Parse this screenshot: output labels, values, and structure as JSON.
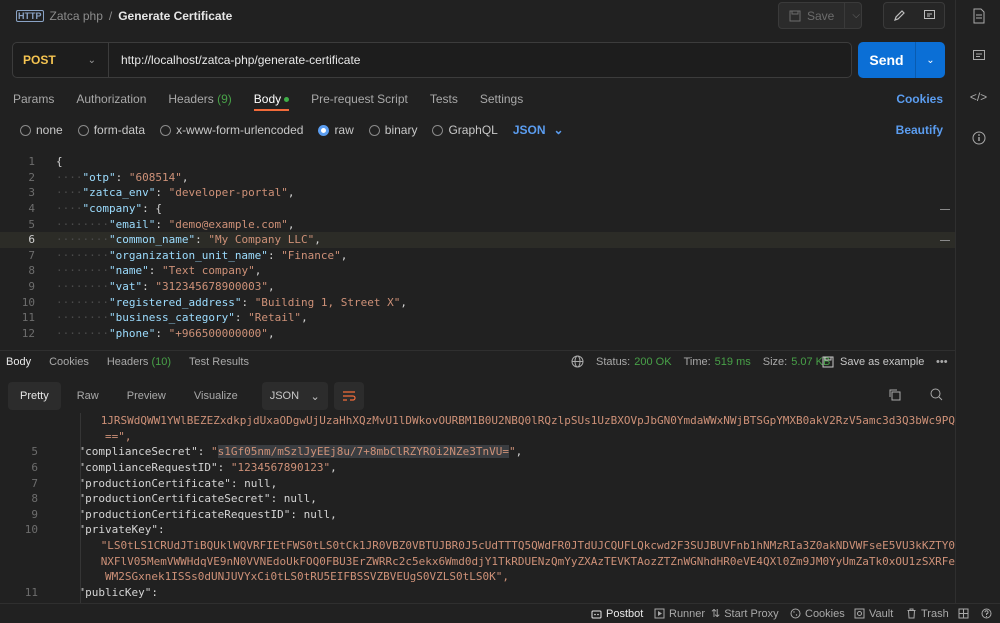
{
  "breadcrumb": {
    "collection": "Zatca php",
    "separator": "/",
    "request": "Generate Certificate",
    "icon": "http-icon"
  },
  "toolbar": {
    "save_label": "Save"
  },
  "request": {
    "method": "POST",
    "url": "http://localhost/zatca-php/generate-certificate",
    "send_label": "Send"
  },
  "req_tabs": [
    {
      "label": "Params"
    },
    {
      "label": "Authorization"
    },
    {
      "label": "Headers",
      "count": "(9)"
    },
    {
      "label": "Body",
      "active": true
    },
    {
      "label": "Pre-request Script"
    },
    {
      "label": "Tests"
    },
    {
      "label": "Settings"
    }
  ],
  "cookies_label": "Cookies",
  "body_types": [
    "none",
    "form-data",
    "x-www-form-urlencoded",
    "raw",
    "binary",
    "GraphQL"
  ],
  "body_selected": "raw",
  "body_format": "JSON",
  "beautify_label": "Beautify",
  "editor_lines": [
    {
      "n": "1",
      "parts": [
        [
          "p",
          "{"
        ]
      ]
    },
    {
      "n": "2",
      "parts": [
        [
          "ws",
          "····"
        ],
        [
          "k",
          "\"otp\""
        ],
        [
          "p",
          ": "
        ],
        [
          "s",
          "\"608514\""
        ],
        [
          "p",
          ","
        ]
      ]
    },
    {
      "n": "3",
      "parts": [
        [
          "ws",
          "····"
        ],
        [
          "k",
          "\"zatca_env\""
        ],
        [
          "p",
          ": "
        ],
        [
          "s",
          "\"developer-portal\""
        ],
        [
          "p",
          ","
        ]
      ]
    },
    {
      "n": "4",
      "parts": [
        [
          "ws",
          "····"
        ],
        [
          "k",
          "\"company\""
        ],
        [
          "p",
          ": {"
        ]
      ]
    },
    {
      "n": "5",
      "parts": [
        [
          "ws",
          "········"
        ],
        [
          "k",
          "\"email\""
        ],
        [
          "p",
          ": "
        ],
        [
          "s",
          "\"demo@example.com\""
        ],
        [
          "p",
          ","
        ]
      ]
    },
    {
      "n": "6",
      "parts": [
        [
          "ws",
          "········"
        ],
        [
          "k",
          "\"common_name\""
        ],
        [
          "p",
          ": "
        ],
        [
          "s",
          "\"My Company LLC\""
        ],
        [
          "p",
          ","
        ]
      ],
      "hl": true
    },
    {
      "n": "7",
      "parts": [
        [
          "ws",
          "········"
        ],
        [
          "k",
          "\"organization_unit_name\""
        ],
        [
          "p",
          ": "
        ],
        [
          "s",
          "\"Finance\""
        ],
        [
          "p",
          ","
        ]
      ]
    },
    {
      "n": "8",
      "parts": [
        [
          "ws",
          "········"
        ],
        [
          "k",
          "\"name\""
        ],
        [
          "p",
          ": "
        ],
        [
          "s",
          "\"Text company\""
        ],
        [
          "p",
          ","
        ]
      ]
    },
    {
      "n": "9",
      "parts": [
        [
          "ws",
          "········"
        ],
        [
          "k",
          "\"vat\""
        ],
        [
          "p",
          ": "
        ],
        [
          "s",
          "\"312345678900003\""
        ],
        [
          "p",
          ","
        ]
      ]
    },
    {
      "n": "10",
      "parts": [
        [
          "ws",
          "········"
        ],
        [
          "k",
          "\"registered_address\""
        ],
        [
          "p",
          ": "
        ],
        [
          "s",
          "\"Building 1, Street X\""
        ],
        [
          "p",
          ","
        ]
      ]
    },
    {
      "n": "11",
      "parts": [
        [
          "ws",
          "········"
        ],
        [
          "k",
          "\"business_category\""
        ],
        [
          "p",
          ": "
        ],
        [
          "s",
          "\"Retail\""
        ],
        [
          "p",
          ","
        ]
      ]
    },
    {
      "n": "12",
      "parts": [
        [
          "ws",
          "········"
        ],
        [
          "k",
          "\"phone\""
        ],
        [
          "p",
          ": "
        ],
        [
          "s",
          "\"+966500000000\""
        ],
        [
          "p",
          ","
        ]
      ]
    }
  ],
  "res_tabs": [
    {
      "label": "Body",
      "active": true
    },
    {
      "label": "Cookies"
    },
    {
      "label": "Headers",
      "count": "(10)"
    },
    {
      "label": "Test Results"
    }
  ],
  "status": {
    "status_label": "Status:",
    "status_value": "200 OK",
    "time_label": "Time:",
    "time_value": "519 ms",
    "size_label": "Size:",
    "size_value": "5.07 KB"
  },
  "save_example_label": "Save as example",
  "view_tabs": [
    "Pretty",
    "Raw",
    "Preview",
    "Visualize"
  ],
  "view_format": "JSON",
  "response_lines": [
    {
      "n": "",
      "indent": "        ",
      "parts": [
        [
          "rs",
          "1JRSWdQWW1YWlBEZEZxdkpjdUxaODgwUjUzaHhXQzMvU1lDWkovOURBM1B0U2NBQ0lRQzlpSUs1UzBXOVpJbGN0YmdaWWxNWjBTSGpYMXB0akV2RzV5amc3d3Q3bWc9PQ"
        ]
      ]
    },
    {
      "n": "",
      "indent": "        ",
      "parts": [
        [
          "rs",
          "==\","
        ]
      ]
    },
    {
      "n": "5",
      "indent": "    ",
      "parts": [
        [
          "rk",
          "\"complianceSecret\""
        ],
        [
          "rk",
          ": "
        ],
        [
          "rs",
          "\""
        ],
        [
          "rs sel",
          "s1Gf05nm/mSzlJyEEj8u/7+8mbClRZYROi2NZe3TnVU="
        ],
        [
          "rs",
          "\""
        ],
        [
          "rk",
          ","
        ]
      ]
    },
    {
      "n": "6",
      "indent": "    ",
      "parts": [
        [
          "rk",
          "\"complianceRequestID\""
        ],
        [
          "rk",
          ": "
        ],
        [
          "rs",
          "\"1234567890123\""
        ],
        [
          "rk",
          ","
        ]
      ]
    },
    {
      "n": "7",
      "indent": "    ",
      "parts": [
        [
          "rk",
          "\"productionCertificate\""
        ],
        [
          "rk",
          ": null,"
        ]
      ]
    },
    {
      "n": "8",
      "indent": "    ",
      "parts": [
        [
          "rk",
          "\"productionCertificateSecret\""
        ],
        [
          "rk",
          ": null,"
        ]
      ]
    },
    {
      "n": "9",
      "indent": "    ",
      "parts": [
        [
          "rk",
          "\"productionCertificateRequestID\""
        ],
        [
          "rk",
          ": null,"
        ]
      ]
    },
    {
      "n": "10",
      "indent": "    ",
      "parts": [
        [
          "rk",
          "\"privateKey\""
        ],
        [
          "rk",
          ":"
        ]
      ]
    },
    {
      "n": "",
      "indent": "        ",
      "parts": [
        [
          "rs",
          "\"LS0tLS1CRUdJTiBQUklWQVRFIEtFWS0tLS0tCk1JR0VBZ0VBTUJBR0J5cUdTTTQ5QWdFR0JTdUJCQUFLQkcwd2F3SUJBUVFnb1hNMzRIa3Z0akNDVWFseE5VU3kKZTY0"
        ]
      ]
    },
    {
      "n": "",
      "indent": "        ",
      "parts": [
        [
          "rs",
          "NXFlV05MemVWWHdqVE9nN0VVNEdoUkFOQ0FBU3ErZWRRc2c5ekx6Wmd0djY1TkRDUENzQmYyZXAzTEVKTAozZTZnWGNhdHR0eVE4QXl0Zm9JM0YyUmZaTk0xOU1zSXRFe"
        ]
      ]
    },
    {
      "n": "",
      "indent": "        ",
      "parts": [
        [
          "rs",
          "WM2SGxnek1ISSs0dUNJUVYxCi0tLS0tRU5EIFBSSVZBVEUgS0VZLS0tLS0K\","
        ]
      ]
    },
    {
      "n": "11",
      "indent": "    ",
      "parts": [
        [
          "rk",
          "\"publicKey\""
        ],
        [
          "rk",
          ":"
        ]
      ]
    }
  ],
  "statusbar": [
    "Postbot",
    "Runner",
    "Start Proxy",
    "Cookies",
    "Vault",
    "Trash"
  ],
  "colors": {
    "accent": "#0b6fd6",
    "method": "#f5c451",
    "link": "#5b9df0",
    "status_ok": "#48a148",
    "tab_underline": "#f26b3a"
  }
}
